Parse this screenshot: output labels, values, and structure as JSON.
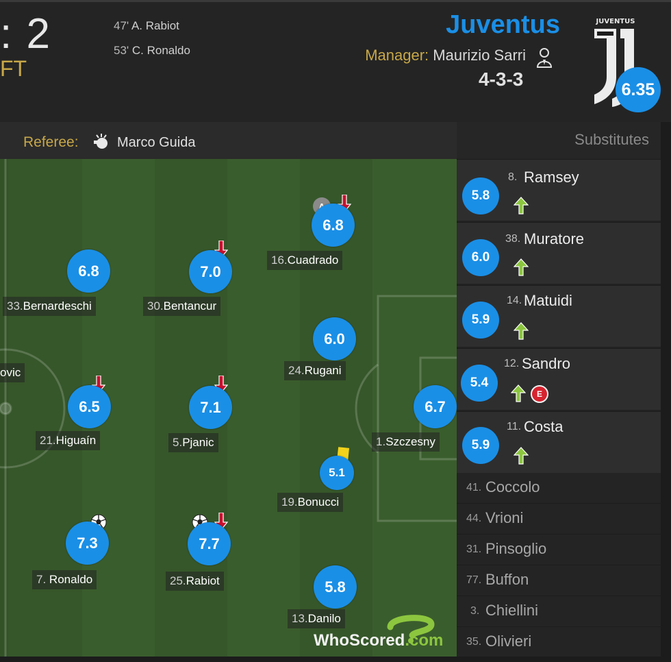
{
  "header": {
    "score": ": 2",
    "status": "FT",
    "goals": [
      {
        "minute": "47'",
        "scorer": "A. Rabiot"
      },
      {
        "minute": "53'",
        "scorer": "C. Ronaldo"
      }
    ],
    "team": "Juventus",
    "manager_label": "Manager:",
    "manager_name": "Maurizio Sarri",
    "formation": "4-3-3",
    "team_rating": "6.35",
    "crest_text": "JUVENTUS"
  },
  "referee": {
    "label": "Referee:",
    "name": "Marco Guida"
  },
  "substitutes_title": "Substitutes",
  "pitch_players": {
    "cuadrado": {
      "rating": "6.8",
      "num": "16.",
      "name": "Cuadrado",
      "captain": "A"
    },
    "bernardeschi": {
      "rating": "6.8",
      "num": "33.",
      "name": "Bernardeschi"
    },
    "bentancur": {
      "rating": "7.0",
      "num": "30.",
      "name": "Bentancur"
    },
    "rugani": {
      "rating": "6.0",
      "num": "24.",
      "name": "Rugani"
    },
    "higuain": {
      "rating": "6.5",
      "num": "21.",
      "name": "Higuaín"
    },
    "pjanic": {
      "rating": "7.1",
      "num": "5.",
      "name": "Pjanic"
    },
    "szczesny": {
      "rating": "6.7",
      "num": "1.",
      "name": "Szczesny"
    },
    "bonucci": {
      "rating": "5.1",
      "num": "19.",
      "name": "Bonucci"
    },
    "ronaldo": {
      "rating": "7.3",
      "num": "7.",
      "name": "Ronaldo"
    },
    "rabiot": {
      "rating": "7.7",
      "num": "25.",
      "name": "Rabiot"
    },
    "danilo": {
      "rating": "5.8",
      "num": "13.",
      "name": "Danilo"
    },
    "opp_partial": {
      "name": "ovic"
    }
  },
  "subs_used": [
    {
      "rating": "5.8",
      "num": "8.",
      "name": "Ramsey"
    },
    {
      "rating": "6.0",
      "num": "38.",
      "name": "Muratore"
    },
    {
      "rating": "5.9",
      "num": "14.",
      "name": "Matuidi"
    },
    {
      "rating": "5.4",
      "num": "12.",
      "name": "Sandro",
      "card_letter": "E"
    },
    {
      "rating": "5.9",
      "num": "11.",
      "name": "Costa"
    }
  ],
  "bench": [
    {
      "num": "41.",
      "name": "Coccolo"
    },
    {
      "num": "44.",
      "name": "Vrioni"
    },
    {
      "num": "31.",
      "name": "Pinsoglio"
    },
    {
      "num": "77.",
      "name": "Buffon"
    },
    {
      "num": "3.",
      "name": "Chiellini"
    },
    {
      "num": "35.",
      "name": "Olivieri"
    }
  ],
  "watermark": {
    "part1": "WhoScored",
    "part2": ".com"
  },
  "colors": {
    "rating_blue": "#1a8fe6",
    "accent_gold": "#c8a848",
    "pitch_green": "#36572a",
    "arrow_up_green": "#8cc63f",
    "arrow_down_red": "#c8102e"
  }
}
